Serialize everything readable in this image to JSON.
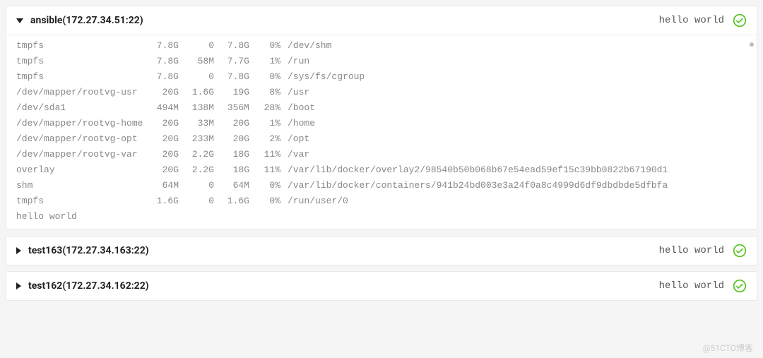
{
  "hosts": [
    {
      "name": "ansible",
      "addr": "172.27.34.51:22",
      "status": "hello world",
      "expanded": true,
      "output_rows": [
        {
          "fs": "tmpfs",
          "size": "7.8G",
          "used": "0",
          "avail": "7.8G",
          "pct": "0%",
          "mount": "/dev/shm"
        },
        {
          "fs": "tmpfs",
          "size": "7.8G",
          "used": "58M",
          "avail": "7.7G",
          "pct": "1%",
          "mount": "/run"
        },
        {
          "fs": "tmpfs",
          "size": "7.8G",
          "used": "0",
          "avail": "7.8G",
          "pct": "0%",
          "mount": "/sys/fs/cgroup"
        },
        {
          "fs": "/dev/mapper/rootvg-usr",
          "size": "20G",
          "used": "1.6G",
          "avail": "19G",
          "pct": "8%",
          "mount": "/usr"
        },
        {
          "fs": "/dev/sda1",
          "size": "494M",
          "used": "138M",
          "avail": "356M",
          "pct": "28%",
          "mount": "/boot"
        },
        {
          "fs": "/dev/mapper/rootvg-home",
          "size": "20G",
          "used": "33M",
          "avail": "20G",
          "pct": "1%",
          "mount": "/home"
        },
        {
          "fs": "/dev/mapper/rootvg-opt",
          "size": "20G",
          "used": "233M",
          "avail": "20G",
          "pct": "2%",
          "mount": "/opt"
        },
        {
          "fs": "/dev/mapper/rootvg-var",
          "size": "20G",
          "used": "2.2G",
          "avail": "18G",
          "pct": "11%",
          "mount": "/var"
        },
        {
          "fs": "overlay",
          "size": "20G",
          "used": "2.2G",
          "avail": "18G",
          "pct": "11%",
          "mount": "/var/lib/docker/overlay2/98540b50b068b67e54ead59ef15c39bb0822b67190d1"
        },
        {
          "fs": "shm",
          "size": "64M",
          "used": "0",
          "avail": "64M",
          "pct": "0%",
          "mount": "/var/lib/docker/containers/941b24bd003e3a24f0a8c4999d6df9dbdbde5dfbfa"
        },
        {
          "fs": "tmpfs",
          "size": "1.6G",
          "used": "0",
          "avail": "1.6G",
          "pct": "0%",
          "mount": "/run/user/0"
        }
      ],
      "trailer": "hello world"
    },
    {
      "name": "test163",
      "addr": "172.27.34.163:22",
      "status": "hello world",
      "expanded": false
    },
    {
      "name": "test162",
      "addr": "172.27.34.162:22",
      "status": "hello world",
      "expanded": false
    }
  ],
  "watermark": "@51CTO博客",
  "colors": {
    "success": "#52c41a"
  }
}
